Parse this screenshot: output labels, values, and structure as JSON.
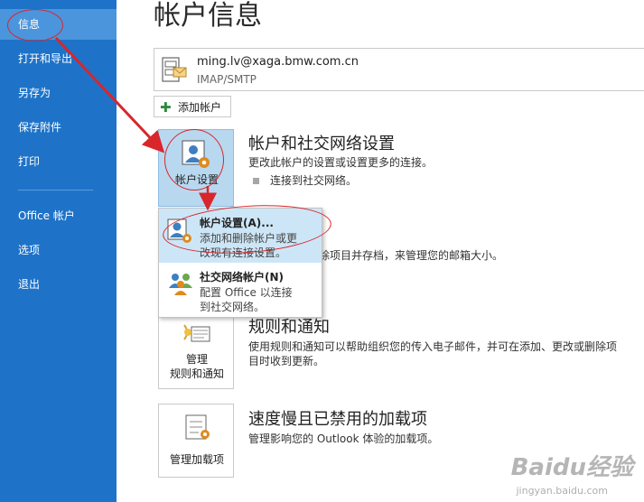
{
  "sidebar": {
    "items": [
      {
        "label": "信息",
        "active": true
      },
      {
        "label": "打开和导出"
      },
      {
        "label": "另存为"
      },
      {
        "label": "保存附件"
      },
      {
        "label": "打印"
      },
      {
        "label": "Office 帐户"
      },
      {
        "label": "选项"
      },
      {
        "label": "退出"
      }
    ],
    "background": "#1e73c8",
    "active_background": "#4b95dc"
  },
  "main": {
    "title": "帐户信息",
    "account": {
      "email": "ming.lv@xaga.bmw.com.cn",
      "type": "IMAP/SMTP"
    },
    "add_account_label": "添加帐户",
    "sections": [
      {
        "button_label": "帐户设置",
        "title": "帐户和社交网络设置",
        "description": "更改此帐户的设置或设置更多的连接。",
        "bullet": "连接到社交网络。"
      },
      {
        "description_fragment": "除项目并存档，来管理您的邮箱大小。"
      },
      {
        "button_label_line1": "管理",
        "button_label_line2": "规则和通知",
        "title": "规则和通知",
        "description_line1": "使用规则和通知可以帮助组织您的传入电子邮件，并可在添加、更改或删除项",
        "description_line2": "目时收到更新。"
      },
      {
        "button_label": "管理加载项",
        "title": "速度慢且已禁用的加载项",
        "description": "管理影响您的 Outlook 体验的加载项。"
      }
    ]
  },
  "dropdown": {
    "items": [
      {
        "title": "帐户设置(A)...",
        "desc_line1": "添加和删除帐户或更",
        "desc_line2": "改现有连接设置。"
      },
      {
        "title": "社交网络帐户(N)",
        "desc_line1": "配置 Office 以连接",
        "desc_line2": "到社交网络。"
      }
    ]
  },
  "watermark": {
    "text": "Baidu经验",
    "sub": "jingyan.baidu.com"
  },
  "annotation_color": "#d8262b"
}
